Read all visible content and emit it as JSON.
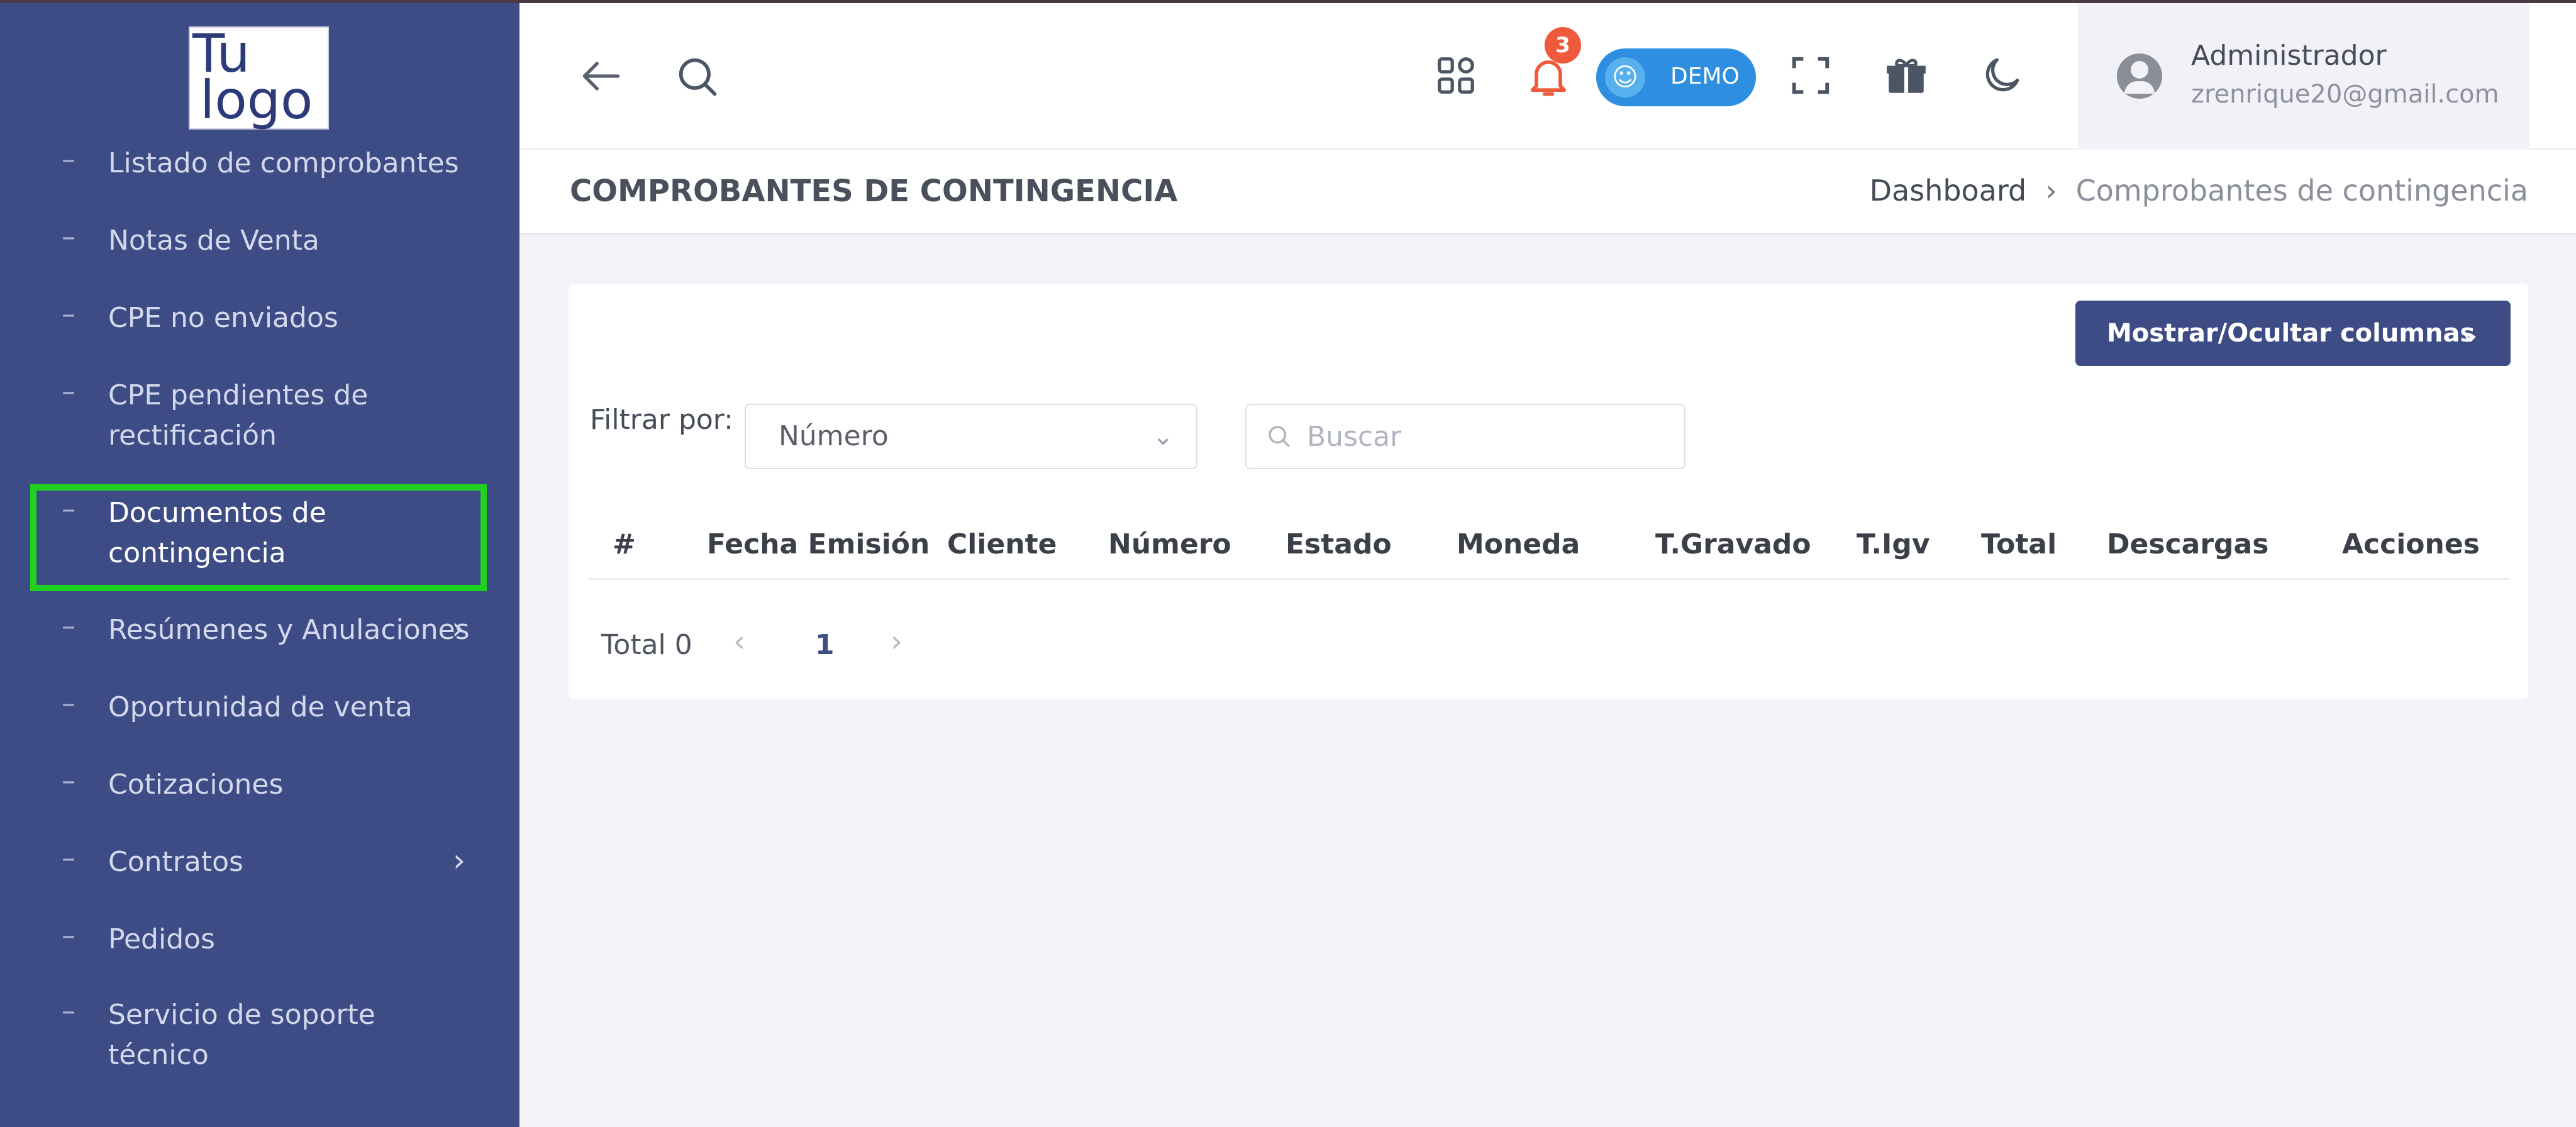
{
  "brand": {
    "logo_line1": "Tu",
    "logo_line2": "logo"
  },
  "sidebar": {
    "items": [
      {
        "label": "Listado de comprobantes"
      },
      {
        "label": "Notas de Venta"
      },
      {
        "label": "CPE no enviados"
      },
      {
        "label": "CPE pendientes de rectificación"
      },
      {
        "label": "Documentos de contingencia",
        "active": true
      },
      {
        "label": "Resúmenes y Anulaciones"
      },
      {
        "label": "Oportunidad de venta"
      },
      {
        "label": "Cotizaciones"
      },
      {
        "label": "Contratos"
      },
      {
        "label": "Pedidos"
      },
      {
        "label": "Servicio de soporte técnico"
      }
    ]
  },
  "header": {
    "notifications_count": "3",
    "demo_label": "DEMO",
    "user_name": "Administrador",
    "user_email": "zrenrique20@gmail.com"
  },
  "page": {
    "title": "COMPROBANTES DE CONTINGENCIA",
    "breadcrumb": [
      "Dashboard",
      "Comprobantes de contingencia"
    ]
  },
  "toolbar": {
    "columns_button": "Mostrar/Ocultar columnas",
    "filter_label": "Filtrar por:",
    "filter_value": "Número",
    "search_placeholder": "Buscar"
  },
  "table": {
    "columns": [
      "#",
      "Fecha Emisión",
      "Cliente",
      "Número",
      "Estado",
      "Moneda",
      "T.Gravado",
      "T.Igv",
      "Total",
      "Descargas",
      "Acciones"
    ],
    "rows": []
  },
  "pagination": {
    "total_label": "Total 0",
    "current_page": "1"
  },
  "colors": {
    "sidebar": "#3e4c85",
    "active_outline": "#1fd21f",
    "badge": "#ef5a3c",
    "demo": "#2e8fe0"
  }
}
